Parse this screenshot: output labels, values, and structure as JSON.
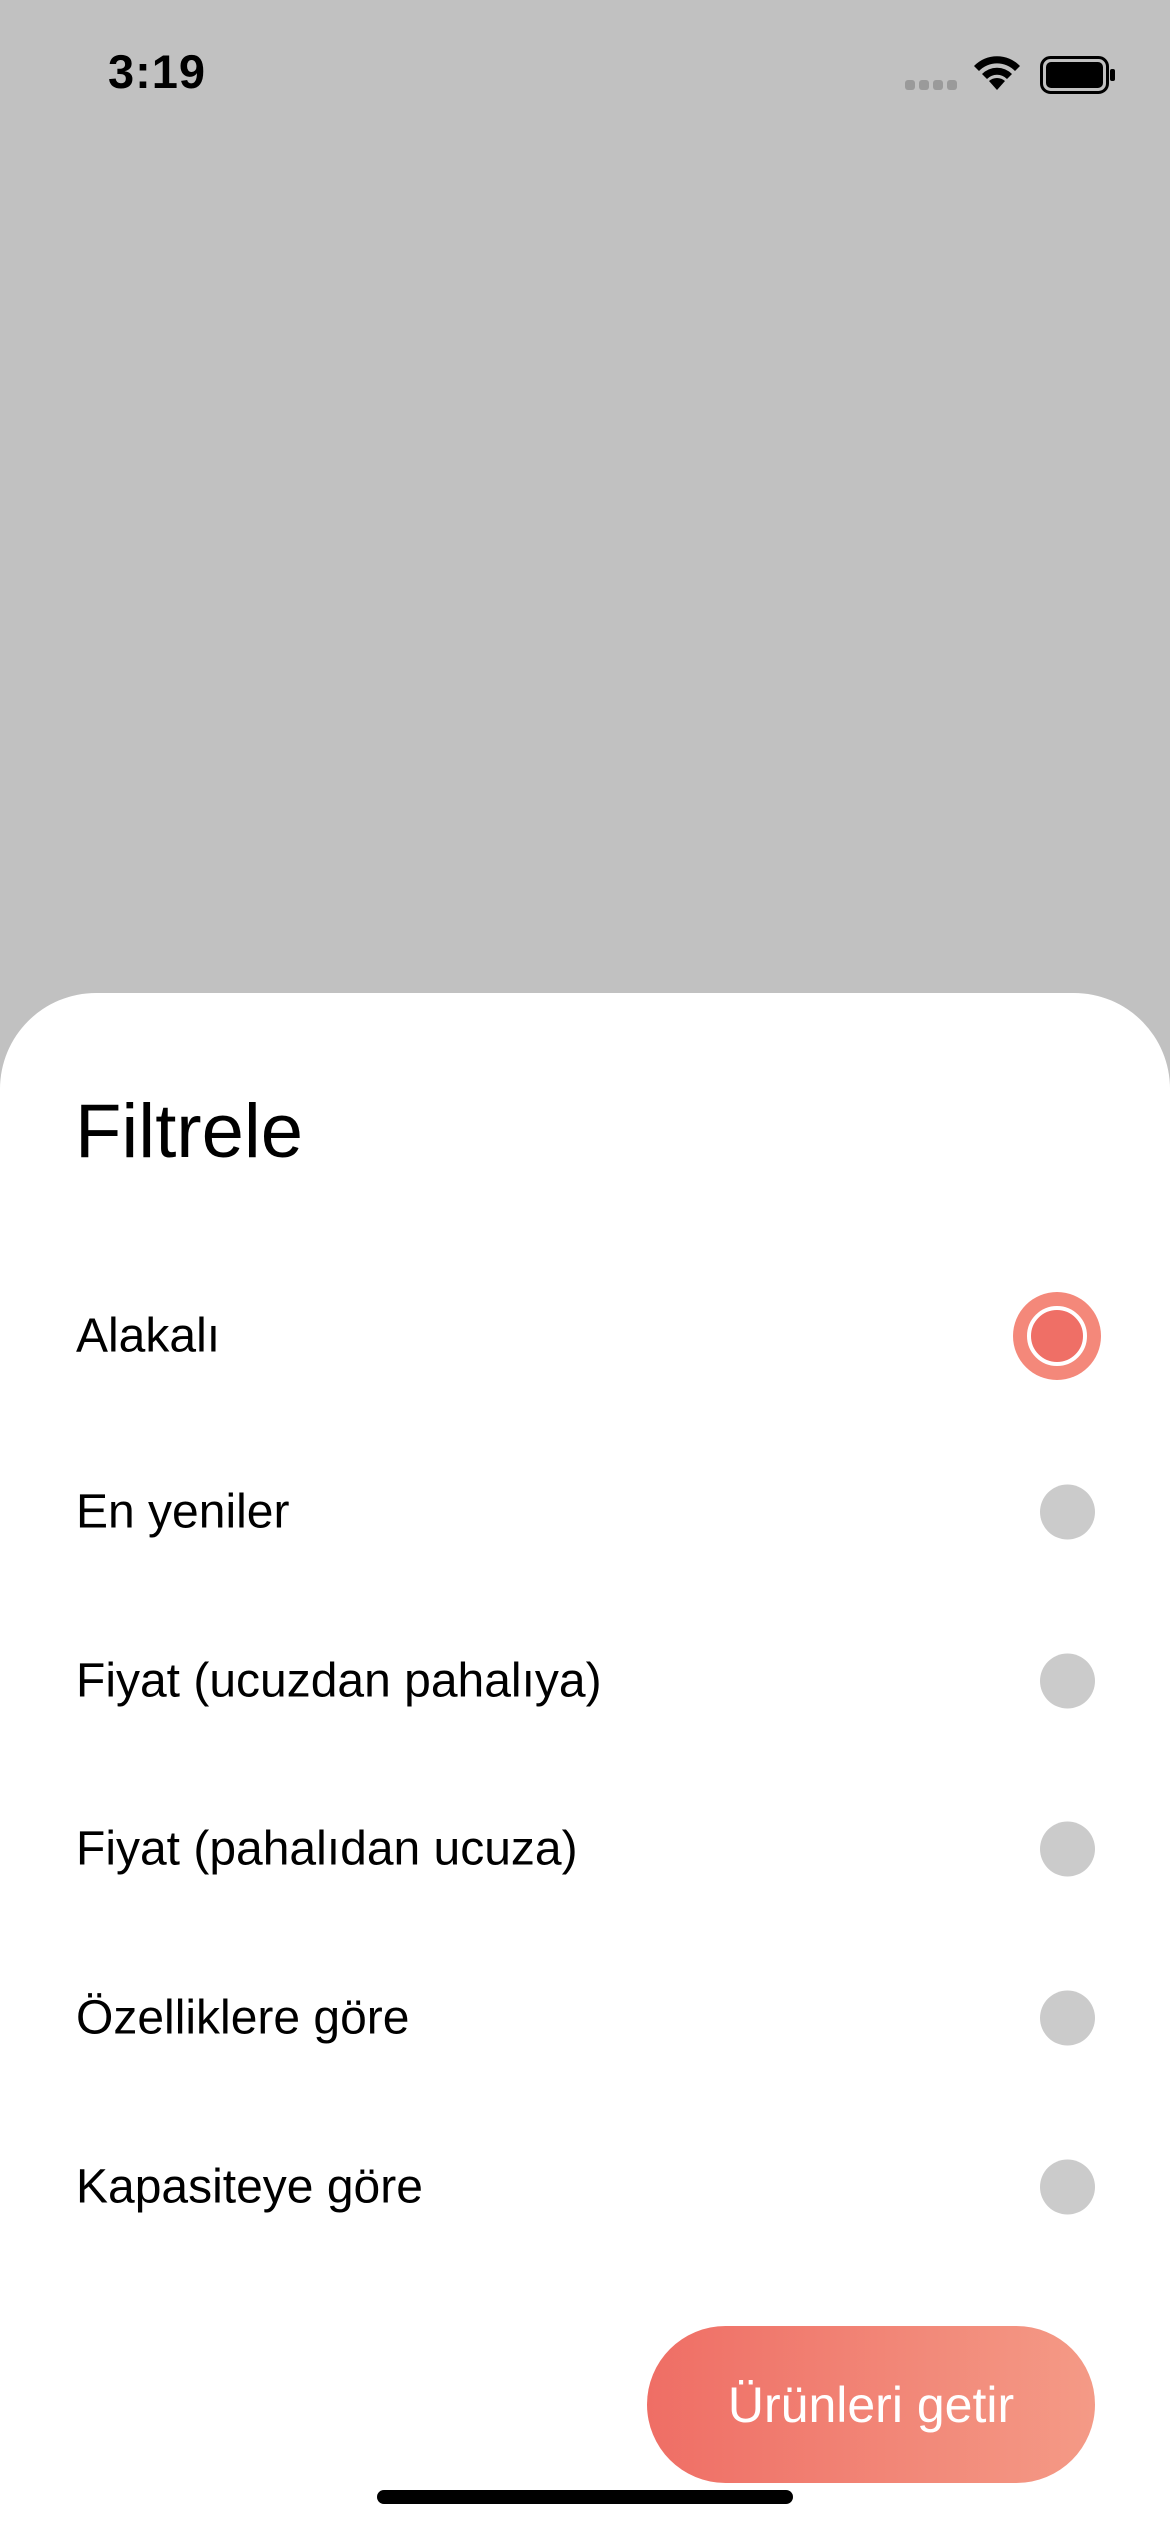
{
  "status_bar": {
    "time": "3:19",
    "icons": [
      "cellular-signal-icon",
      "wifi-icon",
      "battery-icon"
    ]
  },
  "sheet": {
    "title": "Filtrele",
    "options": [
      {
        "label": "Alakalı",
        "selected": true
      },
      {
        "label": "En yeniler",
        "selected": false
      },
      {
        "label": "Fiyat (ucuzdan pahalıya)",
        "selected": false
      },
      {
        "label": "Fiyat (pahalıdan ucuza)",
        "selected": false
      },
      {
        "label": "Özelliklere göre",
        "selected": false
      },
      {
        "label": "Kapasiteye göre",
        "selected": false
      }
    ],
    "submit_label": "Ürünleri getir"
  },
  "colors": {
    "backdrop": "#c1c1c1",
    "accent": "#ef6f66",
    "accent_light": "#f49a86",
    "radio_off": "#cbcbcb"
  }
}
